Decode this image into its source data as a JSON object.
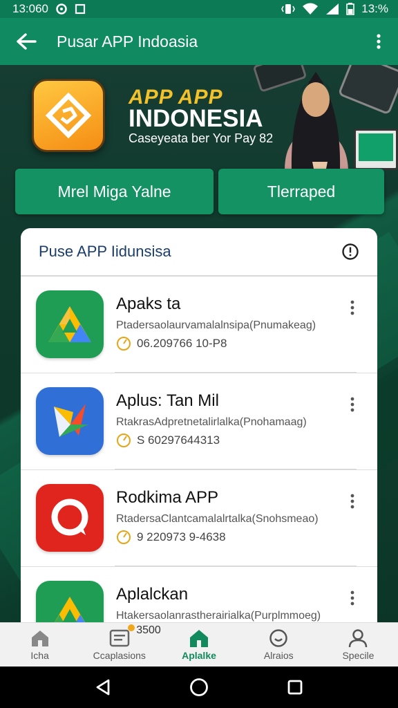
{
  "status_bar": {
    "time": "13:060",
    "battery": "13:%"
  },
  "app_bar": {
    "title": "Pusar APP Indoasia"
  },
  "hero": {
    "brand": "APP APP",
    "title": "INDONESIA",
    "tagline": "Caseyeata ber Yor Pay 82",
    "button_left": "Mrel Miga Yalne",
    "button_right": "Tlerraped"
  },
  "card": {
    "title": "Puse APP Iidunsisa",
    "apps": [
      {
        "name": "Apaks ta",
        "description": "Ptadersaolaurvamalalnsipa(Pnumakeag)",
        "meta": "06.209766 10-P8",
        "icon": "drive-triangle-icon",
        "color": "#1f9d55"
      },
      {
        "name": "Aplus: Tan Mil",
        "description": "RtakrasAdpretnetalirlalka(Pnohamaag)",
        "meta": "S 60297644313",
        "icon": "arrow-shape-icon",
        "color": "#2f6fd6"
      },
      {
        "name": "Rodkima APP",
        "description": "RtadersaClantcamalalrtalka(Snohsmeao)",
        "meta": "9 220973 9-4638",
        "icon": "chat-bubble-icon",
        "color": "#e0251e"
      },
      {
        "name": "Aplalckan",
        "description": "Htakersaolanrastherairialka(Purplmmoeg)",
        "meta": "",
        "icon": "drive-triangle-icon",
        "color": "#1f9d55"
      }
    ]
  },
  "bottom_nav": {
    "items": [
      {
        "label": "Icha",
        "icon": "home-icon",
        "active": false
      },
      {
        "label": "Ccaplasions",
        "icon": "list-card-icon",
        "active": false,
        "badge": "3500"
      },
      {
        "label": "Aplalke",
        "icon": "home-icon",
        "active": true
      },
      {
        "label": "Alraios",
        "icon": "clock-icon",
        "active": false
      },
      {
        "label": "Specile",
        "icon": "person-icon",
        "active": false
      }
    ]
  },
  "colors": {
    "primary": "#108a60",
    "accent": "#f3c22b",
    "card_title": "#1a3d6b"
  }
}
